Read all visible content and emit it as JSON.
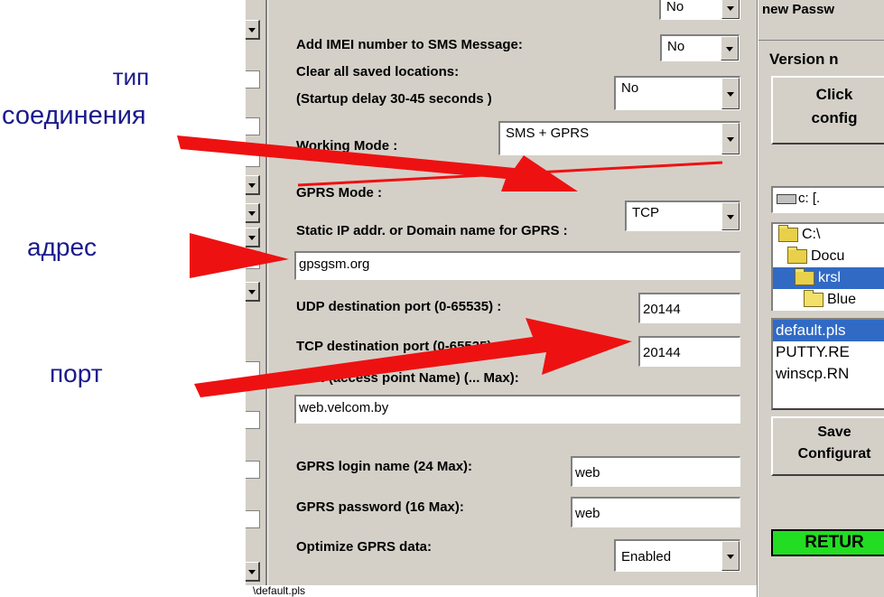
{
  "form": {
    "top_select_value": "No",
    "imei_label": "Add IMEI number to SMS Message:",
    "imei_value": "No",
    "clear_label_1": "Clear all saved locations:",
    "clear_label_2": "(Startup delay 30-45 seconds )",
    "clear_value": "No",
    "working_mode_label": "Working Mode :",
    "working_mode_value": "SMS + GPRS",
    "gprs_mode_label": "GPRS Mode :",
    "gprs_mode_value": "TCP",
    "static_ip_label": "Static IP addr. or Domain name for GPRS :",
    "static_ip_value": "gpsgsm.org",
    "udp_port_label": "UDP destination port (0-65535) :",
    "udp_port_value": "20144",
    "tcp_port_label": "TCP destination port (0-65535) :",
    "tcp_port_value": "20144",
    "apn_label": "APN (access point Name) (... Max):",
    "apn_value": "web.velcom.by",
    "login_label": "GPRS login name (24 Max):",
    "login_value": "web",
    "password_label": "GPRS password  (16 Max):",
    "password_value": "web",
    "optimize_label": "Optimize GPRS data:",
    "optimize_value": "Enabled"
  },
  "right_panel": {
    "new_password_label": "new Passw",
    "version_label": "Version n",
    "click_config_line1": "Click",
    "click_config_line2": "config",
    "drive_value": "c: [.",
    "folders": [
      "C:\\",
      "Docu",
      "krsl",
      "Blue"
    ],
    "files": [
      "default.pls",
      "PUTTY.RE",
      "winscp.RN"
    ],
    "save_line1": "Save",
    "save_line2": "Configurat",
    "return_label": "RETUR"
  },
  "status_bar": {
    "path": "\\default.pls"
  },
  "annotations": {
    "connection_type": "тип\nсоединения",
    "address": "адрес",
    "port": "порт"
  },
  "colors": {
    "window_bg": "#d4d0c8",
    "selection": "#316ac5",
    "annotation_text": "#1a1a8c",
    "arrow": "#ee1111",
    "return_button": "#22dd22"
  }
}
